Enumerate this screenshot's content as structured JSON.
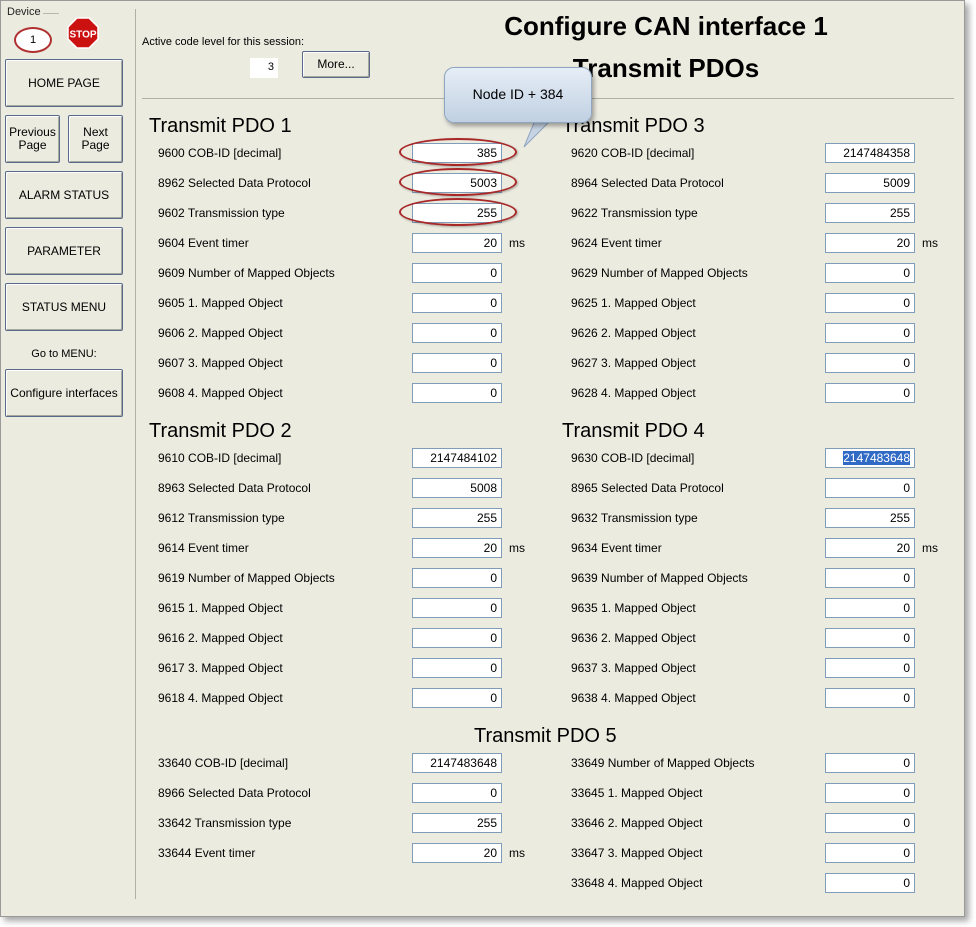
{
  "sidebar": {
    "device_label": "Device",
    "device_value": "1",
    "stop_text": "STOP",
    "home": "HOME PAGE",
    "previous_page": [
      "Previous",
      "Page"
    ],
    "next_page": [
      "Next",
      "Page"
    ],
    "alarm_status": "ALARM STATUS",
    "parameter": "PARAMETER",
    "status_menu": "STATUS MENU",
    "goto_menu_label": "Go to MENU:",
    "configure_interfaces": "Configure interfaces"
  },
  "header": {
    "title": "Configure CAN interface 1",
    "subtitle": "Transmit PDOs",
    "code_level_label": "Active code level for this session:",
    "code_level_value": "3",
    "more_button": "More..."
  },
  "callout": {
    "text": "Node ID + 384"
  },
  "unit_ms": "ms",
  "groups": {
    "pdo1": {
      "title": "Transmit PDO 1",
      "rows": [
        {
          "label": "9600 COB-ID [decimal]",
          "value": "385"
        },
        {
          "label": "8962 Selected Data Protocol",
          "value": "5003"
        },
        {
          "label": "9602 Transmission type",
          "value": "255"
        },
        {
          "label": "9604 Event timer",
          "value": "20"
        },
        {
          "label": "9609 Number of Mapped Objects",
          "value": "0"
        },
        {
          "label": "9605 1. Mapped Object",
          "value": "0"
        },
        {
          "label": "9606 2. Mapped Object",
          "value": "0"
        },
        {
          "label": "9607 3. Mapped Object",
          "value": "0"
        },
        {
          "label": "9608 4. Mapped Object",
          "value": "0"
        }
      ]
    },
    "pdo2": {
      "title": "Transmit PDO 2",
      "rows": [
        {
          "label": "9610 COB-ID [decimal]",
          "value": "2147484102"
        },
        {
          "label": "8963 Selected Data Protocol",
          "value": "5008"
        },
        {
          "label": "9612 Transmission type",
          "value": "255"
        },
        {
          "label": "9614 Event timer",
          "value": "20"
        },
        {
          "label": "9619 Number of Mapped Objects",
          "value": "0"
        },
        {
          "label": "9615 1. Mapped Object",
          "value": "0"
        },
        {
          "label": "9616 2. Mapped Object",
          "value": "0"
        },
        {
          "label": "9617 3. Mapped Object",
          "value": "0"
        },
        {
          "label": "9618 4. Mapped Object",
          "value": "0"
        }
      ]
    },
    "pdo3": {
      "title": "Transmit PDO 3",
      "rows": [
        {
          "label": "9620 COB-ID [decimal]",
          "value": "2147484358"
        },
        {
          "label": "8964 Selected Data Protocol",
          "value": "5009"
        },
        {
          "label": "9622 Transmission type",
          "value": "255"
        },
        {
          "label": "9624 Event timer",
          "value": "20"
        },
        {
          "label": "9629 Number of Mapped Objects",
          "value": "0"
        },
        {
          "label": "9625 1. Mapped Object",
          "value": "0"
        },
        {
          "label": "9626 2. Mapped Object",
          "value": "0"
        },
        {
          "label": "9627 3. Mapped Object",
          "value": "0"
        },
        {
          "label": "9628 4. Mapped Object",
          "value": "0"
        }
      ]
    },
    "pdo4": {
      "title": "Transmit PDO 4",
      "rows": [
        {
          "label": "9630 COB-ID [decimal]",
          "value": "2147483648"
        },
        {
          "label": "8965 Selected Data Protocol",
          "value": "0"
        },
        {
          "label": "9632 Transmission type",
          "value": "255"
        },
        {
          "label": "9634 Event timer",
          "value": "20"
        },
        {
          "label": "9639 Number of Mapped Objects",
          "value": "0"
        },
        {
          "label": "9635 1. Mapped Object",
          "value": "0"
        },
        {
          "label": "9636 2. Mapped Object",
          "value": "0"
        },
        {
          "label": "9637 3. Mapped Object",
          "value": "0"
        },
        {
          "label": "9638 4. Mapped Object",
          "value": "0"
        }
      ]
    },
    "pdo5": {
      "title": "Transmit PDO 5",
      "left_rows": [
        {
          "label": "33640 COB-ID [decimal]",
          "value": "2147483648"
        },
        {
          "label": "8966 Selected Data Protocol",
          "value": "0"
        },
        {
          "label": "33642 Transmission type",
          "value": "255"
        },
        {
          "label": "33644 Event timer",
          "value": "20"
        }
      ],
      "right_rows": [
        {
          "label": "33649 Number of Mapped Objects",
          "value": "0"
        },
        {
          "label": "33645 1. Mapped Object",
          "value": "0"
        },
        {
          "label": "33646 2. Mapped Object",
          "value": "0"
        },
        {
          "label": "33647 3. Mapped Object",
          "value": "0"
        },
        {
          "label": "33648 4. Mapped Object",
          "value": "0"
        }
      ]
    }
  },
  "colors": {
    "window_bg": "#ecebe0",
    "highlight_oval": "#a82828",
    "selection": "#316ac5",
    "stop_red": "#cc1111"
  }
}
